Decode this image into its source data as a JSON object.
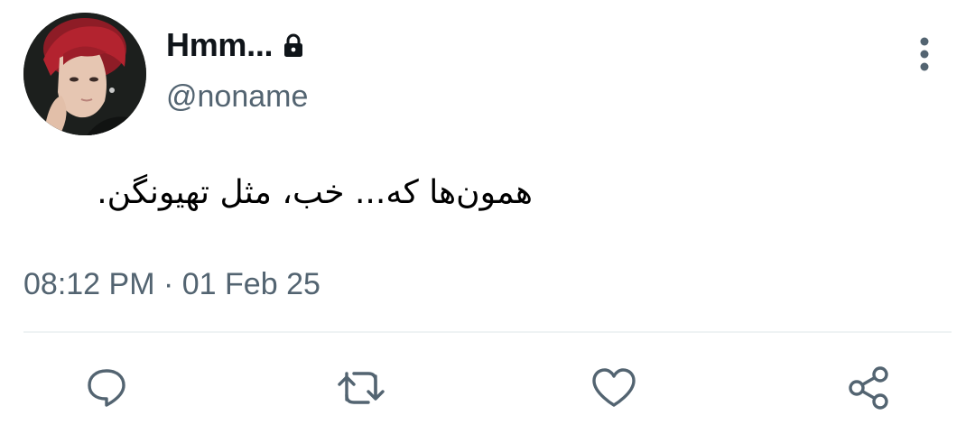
{
  "user": {
    "display_name": "Hmm...",
    "handle": "@noname",
    "protected_icon": "lock-icon",
    "avatar": "profile-photo"
  },
  "tweet": {
    "text": "همون‌ها که... خب، مثل تهیونگن.",
    "time": "08:12 PM",
    "separator": "·",
    "date": "01 Feb 25"
  },
  "menu": {
    "icon": "more-vertical-icon"
  },
  "actions": [
    {
      "name": "reply",
      "icon": "comment-icon"
    },
    {
      "name": "retweet",
      "icon": "retweet-icon"
    },
    {
      "name": "like",
      "icon": "heart-icon"
    },
    {
      "name": "share",
      "icon": "share-icon"
    }
  ],
  "colors": {
    "primary_text": "#0f1419",
    "secondary_text": "#536471",
    "divider": "#eff3f4",
    "avatar_hair": "#a3202a"
  }
}
